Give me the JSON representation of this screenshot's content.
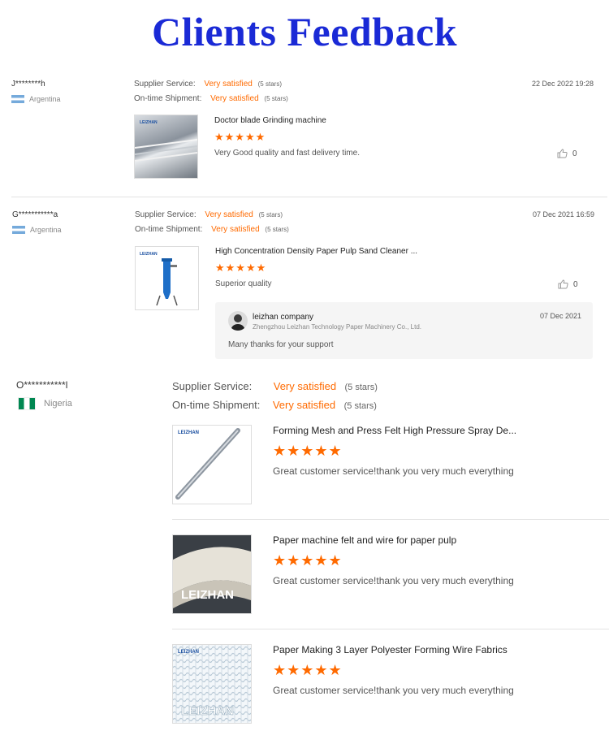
{
  "page_title": "Clients Feedback",
  "labels": {
    "supplier_service": "Supplier Service:",
    "ontime_shipment": "On-time Shipment:"
  },
  "reviews": [
    {
      "name": "J********h",
      "country": "Argentina",
      "supplier_rating": "Very satisfied",
      "supplier_stars": "(5 stars)",
      "shipment_rating": "Very satisfied",
      "shipment_stars": "(5 stars)",
      "date": "22 Dec 2022 19:28",
      "product": "Doctor blade Grinding machine",
      "stars": "★★★★★",
      "comment": "Very Good quality and fast delivery time.",
      "likes": "0"
    },
    {
      "name": "G***********a",
      "country": "Argentina",
      "supplier_rating": "Very satisfied",
      "supplier_stars": "(5 stars)",
      "shipment_rating": "Very satisfied",
      "shipment_stars": "(5 stars)",
      "date": "07 Dec 2021 16:59",
      "product": "High Concentration Density Paper Pulp Sand Cleaner ...",
      "stars": "★★★★★",
      "comment": "Superior quality",
      "likes": "0",
      "reply": {
        "company": "leizhan company",
        "subtitle": "Zhengzhou Leizhan Technology Paper Machinery Co., Ltd.",
        "date": "07 Dec 2021",
        "text": "Many thanks for your support"
      }
    },
    {
      "name": "O***********l",
      "country": "Nigeria",
      "supplier_rating": "Very satisfied",
      "supplier_stars": "(5 stars)",
      "shipment_rating": "Very satisfied",
      "shipment_stars": "(5 stars)",
      "items": [
        {
          "product": "Forming Mesh and Press Felt High Pressure Spray De...",
          "stars": "★★★★★",
          "comment": "Great customer service!thank you very much everything"
        },
        {
          "product": "Paper machine felt and wire for paper pulp",
          "stars": "★★★★★",
          "comment": "Great customer service!thank you very much everything"
        },
        {
          "product": "Paper Making 3 Layer Polyester Forming Wire Fabrics",
          "stars": "★★★★★",
          "comment": "Great customer service!thank you very much everything"
        }
      ]
    }
  ],
  "brand": {
    "logo_text": "LEIZHAN",
    "logo_big": "LEIZHAN"
  },
  "colors": {
    "title": "#1a2ad6",
    "accent": "#ff6a00"
  },
  "icons": {
    "like": "thumbs-up-icon",
    "avatar": "person-avatar-icon"
  }
}
